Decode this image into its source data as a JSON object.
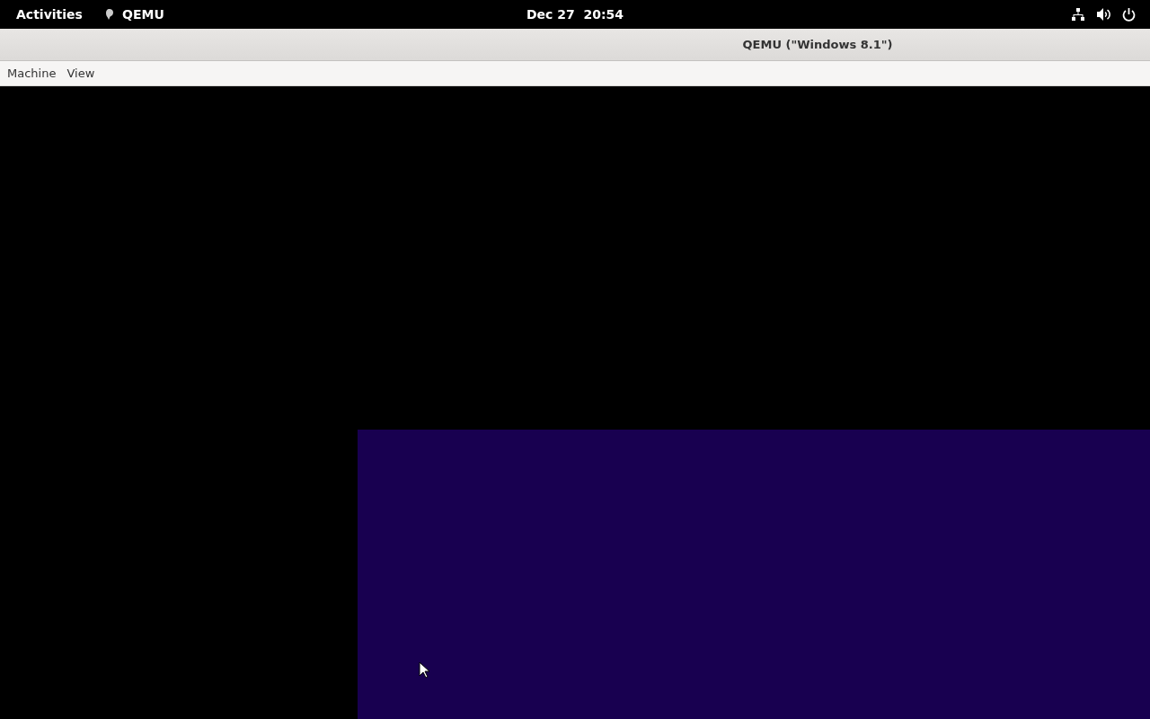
{
  "top_bar": {
    "activities": "Activities",
    "app_name": "QEMU",
    "clock": "Dec 27  20:54"
  },
  "window": {
    "title": "QEMU (\"Windows 8.1\")"
  },
  "menu_bar": {
    "items": [
      "Machine",
      "View"
    ]
  }
}
